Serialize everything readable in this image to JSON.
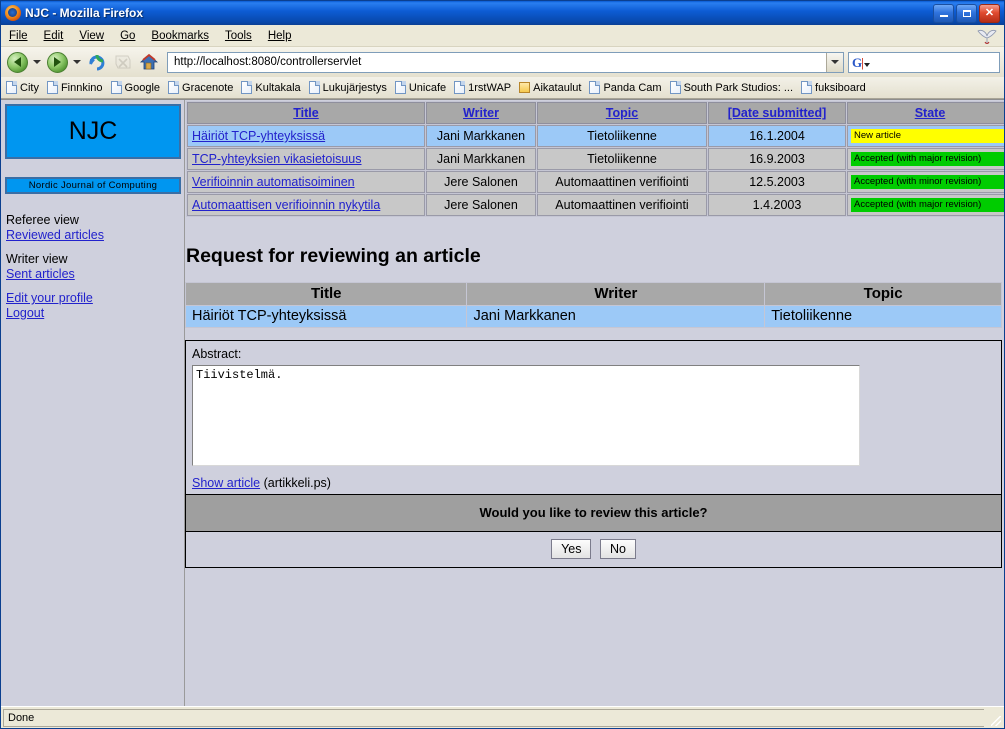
{
  "window": {
    "title": "NJC - Mozilla Firefox",
    "icon": "firefox-icon",
    "minimize_label": "Minimize",
    "maximize_label": "Maximize",
    "close_label": "Close"
  },
  "menubar": {
    "items": [
      {
        "label": "File",
        "accel": "F"
      },
      {
        "label": "Edit",
        "accel": "E"
      },
      {
        "label": "View",
        "accel": "V"
      },
      {
        "label": "Go",
        "accel": "G"
      },
      {
        "label": "Bookmarks",
        "accel": "B"
      },
      {
        "label": "Tools",
        "accel": "T"
      },
      {
        "label": "Help",
        "accel": "H"
      }
    ]
  },
  "toolbar": {
    "back": "Back",
    "forward": "Forward",
    "reload": "Reload",
    "stop": "Stop",
    "home": "Home",
    "url": "http://localhost:8080/controllerservlet",
    "url_placeholder": "",
    "search_placeholder": "",
    "search_value": "",
    "search_engine": "Google"
  },
  "bookmarks": [
    {
      "label": "City",
      "type": "page"
    },
    {
      "label": "Finnkino",
      "type": "page"
    },
    {
      "label": "Google",
      "type": "page"
    },
    {
      "label": "Gracenote",
      "type": "page"
    },
    {
      "label": "Kultakala",
      "type": "page"
    },
    {
      "label": "Lukujärjestys",
      "type": "page"
    },
    {
      "label": "Unicafe",
      "type": "page"
    },
    {
      "label": "1rstWAP",
      "type": "page"
    },
    {
      "label": "Aikataulut",
      "type": "folder"
    },
    {
      "label": "Panda Cam",
      "type": "page"
    },
    {
      "label": "South Park Studios: ...",
      "type": "page"
    },
    {
      "label": "fuksiboard",
      "type": "page"
    }
  ],
  "sidebar": {
    "logo": "NJC",
    "logo_subtitle": "Nordic Journal of Computing",
    "groups": [
      {
        "heading": "Referee view",
        "link": "Reviewed articles"
      },
      {
        "heading": "Writer view",
        "link": "Sent articles"
      }
    ],
    "account_links": [
      "Edit your profile",
      "Logout"
    ]
  },
  "articles_table": {
    "headers": [
      "Title",
      "Writer",
      "Topic",
      "[Date submitted]",
      "State"
    ],
    "rows": [
      {
        "title": "Häiriöt TCP-yhteyksissä",
        "writer": "Jani Markkanen",
        "topic": "Tietoliikenne",
        "date": "16.1.2004",
        "state": "New article",
        "state_color": "yellow",
        "selected": true
      },
      {
        "title": "TCP-yhteyksien vikasietoisuus",
        "writer": "Jani Markkanen",
        "topic": "Tietoliikenne",
        "date": "16.9.2003",
        "state": "Accepted (with major revision)",
        "state_color": "green",
        "selected": false
      },
      {
        "title": "Verifioinnin automatisoiminen",
        "writer": "Jere Salonen",
        "topic": "Automaattinen verifiointi",
        "date": "12.5.2003",
        "state": "Accepted (with minor revision)",
        "state_color": "green",
        "selected": false
      },
      {
        "title": "Automaattisen verifioinnin nykytila",
        "writer": "Jere Salonen",
        "topic": "Automaattinen verifiointi",
        "date": "1.4.2003",
        "state": "Accepted (with major revision)",
        "state_color": "green",
        "selected": false
      }
    ]
  },
  "main": {
    "heading": "Request for reviewing an article",
    "info_headers": [
      "Title",
      "Writer",
      "Topic"
    ],
    "info_row": {
      "title": "Häiriöt TCP-yhteyksissä",
      "writer": "Jani Markkanen",
      "topic": "Tietoliikenne"
    },
    "abstract_label": "Abstract:",
    "abstract_value": "Tiivistelmä.",
    "show_article_link": "Show article",
    "article_filename": "(artikkeli.ps)",
    "question": "Would you like to review this article?",
    "yes_label": "Yes",
    "no_label": "No"
  },
  "statusbar": {
    "text": "Done"
  },
  "colors": {
    "accent_blue": "#0096f0",
    "link": "#2222cc",
    "header_gray": "#a8a8a8",
    "row_gray": "#c8c8c8",
    "row_selected": "#9cc9f7",
    "badge_new": "#ffff00",
    "badge_accepted": "#00cc00",
    "page_bg": "#cfd0dd",
    "question_bg": "#9f9f9f"
  }
}
